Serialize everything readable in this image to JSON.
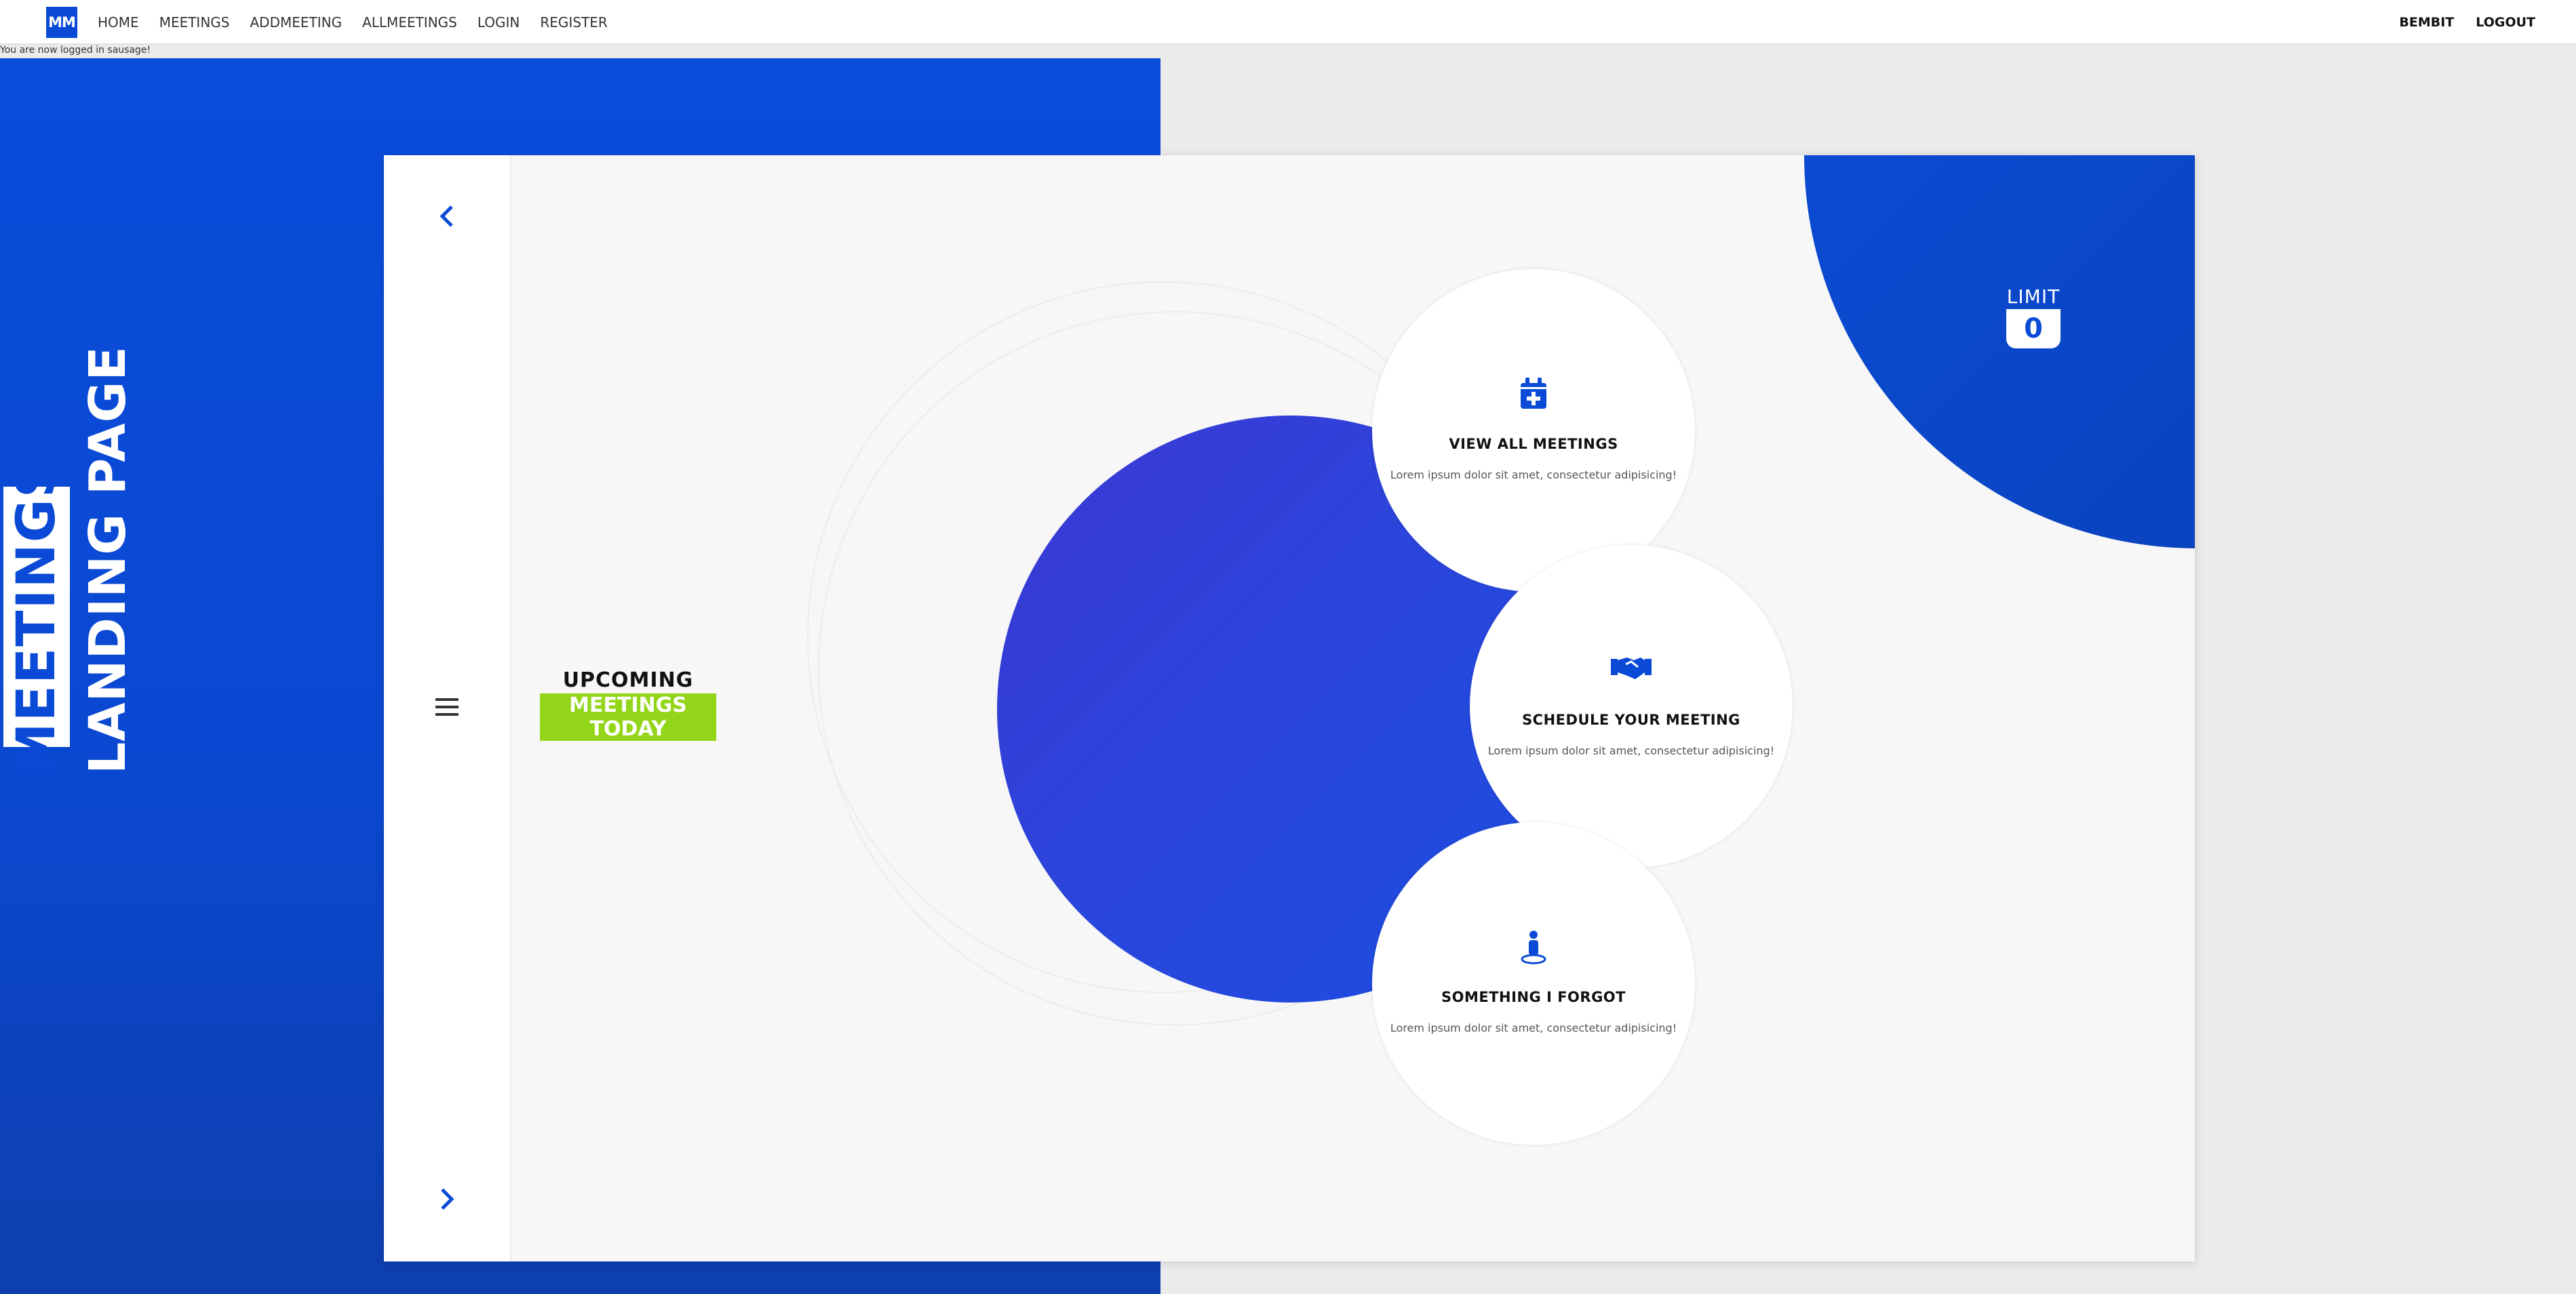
{
  "navbar": {
    "brand": "MM",
    "links": [
      "HOME",
      "MEETINGS",
      "ADDMEETING",
      "ALLMEETINGS",
      "LOGIN",
      "REGISTER"
    ],
    "user": "BEMBIT",
    "logout": "LOGOUT"
  },
  "flash": "You are now logged in sausage!",
  "hero": {
    "title_line1": "MEETINGS",
    "title_line2": "LANDING PAGE"
  },
  "sidebar": {
    "prev_icon": "chevron-left-icon",
    "menu_icon": "hamburger-icon",
    "next_icon": "chevron-right-icon"
  },
  "upcoming": {
    "line1": "UPCOMING",
    "line2": "MEETINGS TODAY"
  },
  "limit": {
    "label": "LIMIT",
    "value": "0"
  },
  "features": [
    {
      "title": "VIEW ALL MEETINGS",
      "desc": "Lorem ipsum dolor sit amet, consectetur adipisicing!",
      "icon": "calendar-plus-icon"
    },
    {
      "title": "SCHEDULE YOUR MEETING",
      "desc": "Lorem ipsum dolor sit amet, consectetur adipisicing!",
      "icon": "handshake-icon"
    },
    {
      "title": "SOMETHING I FORGOT",
      "desc": "Lorem ipsum dolor sit amet, consectetur adipisicing!",
      "icon": "person-pin-icon"
    }
  ],
  "colors": {
    "accent": "#0a4ad6",
    "highlight": "#93d619",
    "circle": "#2f42d8"
  }
}
